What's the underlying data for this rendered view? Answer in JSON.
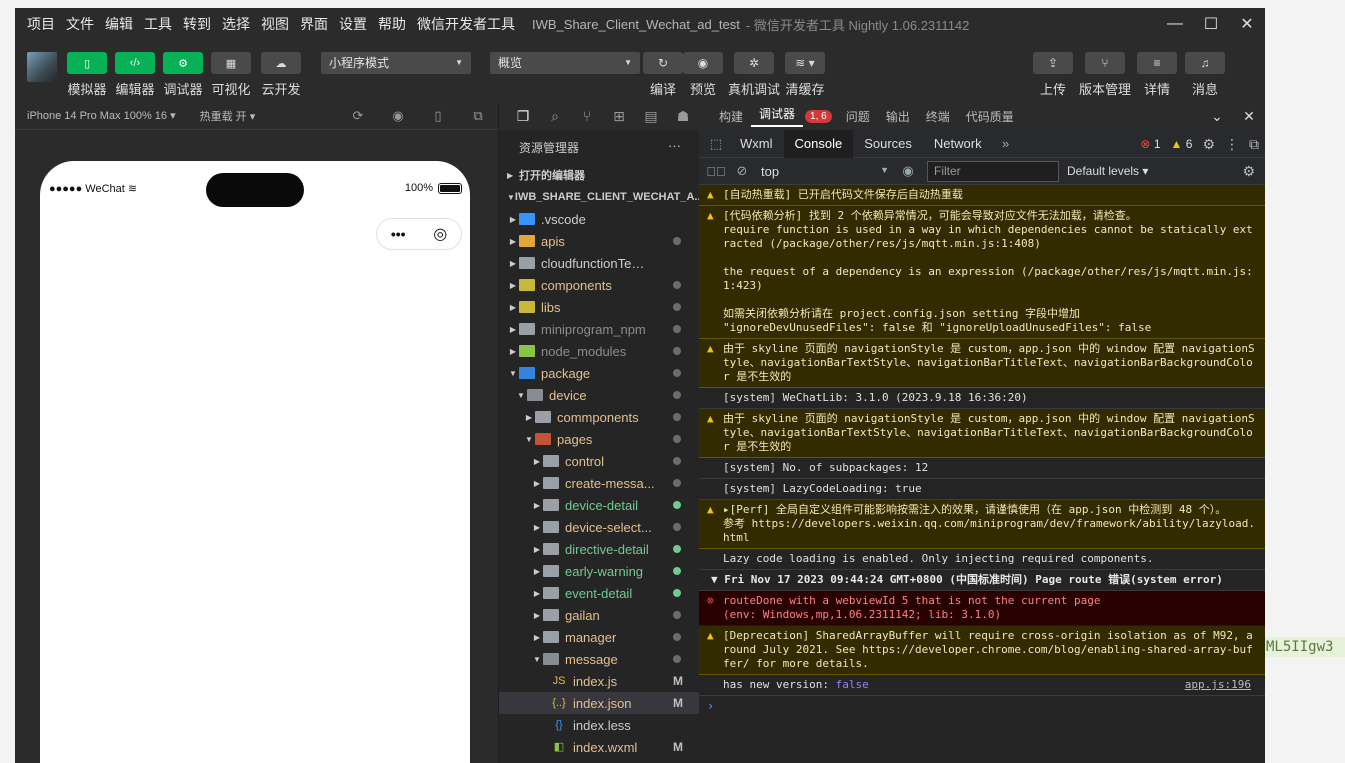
{
  "background_text": "ML5IIgw3",
  "menubar": {
    "items": [
      "项目",
      "文件",
      "编辑",
      "工具",
      "转到",
      "选择",
      "视图",
      "界面",
      "设置",
      "帮助",
      "微信开发者工具"
    ],
    "project_title": "IWB_Share_Client_Wechat_ad_test",
    "app_title": "- 微信开发者工具 Nightly 1.06.2311142"
  },
  "toolbar": {
    "left_buttons": [
      {
        "label": "模拟器",
        "icon": "phone-icon"
      },
      {
        "label": "编辑器",
        "icon": "code-icon"
      },
      {
        "label": "调试器",
        "icon": "debug-icon"
      },
      {
        "label": "可视化",
        "icon": "layout-icon"
      },
      {
        "label": "云开发",
        "icon": "cloud-icon"
      }
    ],
    "mode_select": "小程序模式",
    "compile_select": "概览",
    "center_buttons": [
      {
        "label": "编译",
        "icon": "refresh-icon"
      },
      {
        "label": "预览",
        "icon": "eye-icon"
      },
      {
        "label": "真机调试",
        "icon": "bug-icon"
      },
      {
        "label": "清缓存",
        "icon": "layers-icon"
      }
    ],
    "right_buttons": [
      {
        "label": "上传",
        "icon": "upload-icon"
      },
      {
        "label": "版本管理",
        "icon": "branch-icon"
      },
      {
        "label": "详情",
        "icon": "menu-icon"
      },
      {
        "label": "消息",
        "icon": "bell-icon"
      }
    ]
  },
  "simulator": {
    "device": "iPhone 14 Pro Max 100% 16 ▾",
    "hot_reload": "热重载 开 ▾",
    "status_left": "●●●●● WeChat",
    "battery": "100%",
    "capsule_more": "•••"
  },
  "explorer": {
    "header": "资源管理器",
    "open_editors": "打开的编辑器",
    "project": "IWB_SHARE_CLIENT_WECHAT_A...",
    "tree": [
      {
        "name": ".vscode",
        "depth": 1,
        "kind": "folder",
        "color": "#3794ff",
        "text_color": "#cccccc",
        "expanded": false,
        "dot": false
      },
      {
        "name": "apis",
        "depth": 1,
        "kind": "folder",
        "color": "#e0a73a",
        "text_color": "#e2c08d",
        "expanded": false,
        "dot": true
      },
      {
        "name": "cloudfunctionTemplate",
        "depth": 1,
        "kind": "folder",
        "color": "#9aa0a6",
        "text_color": "#cccccc",
        "expanded": false,
        "dot": false
      },
      {
        "name": "components",
        "depth": 1,
        "kind": "folder",
        "color": "#c5b83a",
        "text_color": "#e2c08d",
        "expanded": false,
        "dot": true
      },
      {
        "name": "libs",
        "depth": 1,
        "kind": "folder",
        "color": "#c5b83a",
        "text_color": "#e2c08d",
        "expanded": false,
        "dot": true
      },
      {
        "name": "miniprogram_npm",
        "depth": 1,
        "kind": "folder",
        "color": "#9aa0a6",
        "text_color": "#8c8c8c",
        "expanded": false,
        "dot": true
      },
      {
        "name": "node_modules",
        "depth": 1,
        "kind": "folder",
        "color": "#8bc34a",
        "text_color": "#8c8c8c",
        "expanded": false,
        "dot": true
      },
      {
        "name": "package",
        "depth": 1,
        "kind": "folder-open",
        "color": "#3794ff",
        "text_color": "#e2c08d",
        "expanded": true,
        "dot": true
      },
      {
        "name": "device",
        "depth": 2,
        "kind": "folder-open",
        "color": "#9aa0a6",
        "text_color": "#e2c08d",
        "expanded": true,
        "dot": true
      },
      {
        "name": "commponents",
        "depth": 3,
        "kind": "folder",
        "color": "#9aa0a6",
        "text_color": "#e2c08d",
        "expanded": false,
        "dot": true
      },
      {
        "name": "pages",
        "depth": 3,
        "kind": "folder-open",
        "color": "#e05a3a",
        "text_color": "#e2c08d",
        "expanded": true,
        "dot": true
      },
      {
        "name": "control",
        "depth": 4,
        "kind": "folder",
        "color": "#9aa0a6",
        "text_color": "#e2c08d",
        "expanded": false,
        "dot": true
      },
      {
        "name": "create-messa...",
        "depth": 4,
        "kind": "folder",
        "color": "#9aa0a6",
        "text_color": "#e2c08d",
        "expanded": false,
        "dot": true
      },
      {
        "name": "device-detail",
        "depth": 4,
        "kind": "folder",
        "color": "#9aa0a6",
        "text_color": "#73c991",
        "expanded": false,
        "dot": true,
        "dot_color": "#73c991"
      },
      {
        "name": "device-select...",
        "depth": 4,
        "kind": "folder",
        "color": "#9aa0a6",
        "text_color": "#e2c08d",
        "expanded": false,
        "dot": true
      },
      {
        "name": "directive-detail",
        "depth": 4,
        "kind": "folder",
        "color": "#9aa0a6",
        "text_color": "#73c991",
        "expanded": false,
        "dot": true,
        "dot_color": "#73c991"
      },
      {
        "name": "early-warning",
        "depth": 4,
        "kind": "folder",
        "color": "#9aa0a6",
        "text_color": "#73c991",
        "expanded": false,
        "dot": true,
        "dot_color": "#73c991"
      },
      {
        "name": "event-detail",
        "depth": 4,
        "kind": "folder",
        "color": "#9aa0a6",
        "text_color": "#73c991",
        "expanded": false,
        "dot": true,
        "dot_color": "#73c991"
      },
      {
        "name": "gailan",
        "depth": 4,
        "kind": "folder",
        "color": "#9aa0a6",
        "text_color": "#e2c08d",
        "expanded": false,
        "dot": true
      },
      {
        "name": "manager",
        "depth": 4,
        "kind": "folder",
        "color": "#9aa0a6",
        "text_color": "#e2c08d",
        "expanded": false,
        "dot": true
      },
      {
        "name": "message",
        "depth": 4,
        "kind": "folder-open",
        "color": "#9aa0a6",
        "text_color": "#e2c08d",
        "expanded": true,
        "dot": true
      },
      {
        "name": "index.js",
        "depth": 5,
        "kind": "file-js",
        "color": "#e0c13a",
        "text_color": "#e2c08d",
        "badge": "M"
      },
      {
        "name": "index.json",
        "depth": 5,
        "kind": "file-json",
        "color": "#e0c13a",
        "text_color": "#e2c08d",
        "badge": "M",
        "selected": true
      },
      {
        "name": "index.less",
        "depth": 5,
        "kind": "file-less",
        "color": "#3794ff",
        "text_color": "#cccccc"
      },
      {
        "name": "index.wxml",
        "depth": 5,
        "kind": "file-wxml",
        "color": "#8bc34a",
        "text_color": "#e2c08d",
        "badge": "M"
      }
    ]
  },
  "devtools": {
    "top_tabs": [
      {
        "label": "构建",
        "active": false
      },
      {
        "label": "调试器",
        "active": true,
        "count": "1, 6"
      },
      {
        "label": "问题",
        "active": false
      },
      {
        "label": "输出",
        "active": false
      },
      {
        "label": "终端",
        "active": false
      },
      {
        "label": "代码质量",
        "active": false
      }
    ],
    "chrome_tabs": [
      {
        "label": "Wxml",
        "active": false
      },
      {
        "label": "Console",
        "active": true
      },
      {
        "label": "Sources",
        "active": false
      },
      {
        "label": "Network",
        "active": false
      }
    ],
    "error_count": "1",
    "warning_count": "6",
    "context": "top",
    "filter_placeholder": "Filter",
    "levels": "Default levels ▾",
    "messages": [
      {
        "type": "warn",
        "text": "[自动热重载] 已开启代码文件保存后自动热重载"
      },
      {
        "type": "warn",
        "text": "[代码依赖分析] 找到 2 个依赖异常情况，可能会导致对应文件无法加载，请检查。\nrequire function is used in a way in which dependencies cannot be statically extracted (/package/other/res/js/mqtt.min.js:1:408)\n\nthe request of a dependency is an expression (/package/other/res/js/mqtt.min.js:1:423)\n\n如需关闭依赖分析请在 project.config.json setting 字段中增加\n\"ignoreDevUnusedFiles\": false 和 \"ignoreUploadUnusedFiles\": false"
      },
      {
        "type": "warn",
        "text": "由于 skyline 页面的 navigationStyle 是 custom，app.json 中的 window 配置 navigationStyle、navigationBarTextStyle、navigationBarTitleText、navigationBarBackgroundColor 是不生效的"
      },
      {
        "type": "log",
        "text": "[system] WeChatLib: 3.1.0 (2023.9.18 16:36:20)"
      },
      {
        "type": "warn",
        "text": "由于 skyline 页面的 navigationStyle 是 custom，app.json 中的 window 配置 navigationStyle、navigationBarTextStyle、navigationBarTitleText、navigationBarBackgroundColor 是不生效的"
      },
      {
        "type": "log",
        "text": "[system] No. of subpackages: 12"
      },
      {
        "type": "log",
        "text": "[system] LazyCodeLoading: true"
      },
      {
        "type": "warn",
        "text": "▸[Perf] 全局自定义组件可能影响按需注入的效果，请谨慎使用（在 app.json 中检测到 48 个）。\n参考 https://developers.weixin.qq.com/miniprogram/dev/framework/ability/lazyload.html"
      },
      {
        "type": "log",
        "text": "Lazy code loading is enabled. Only injecting required components."
      },
      {
        "type": "group",
        "text": "▼ Fri Nov 17 2023 09:44:24 GMT+0800 (中国标准时间) Page route 错误(system error)"
      },
      {
        "type": "err",
        "text": "routeDone with a webviewId 5 that is not the current page\n(env: Windows,mp,1.06.2311142; lib: 3.1.0)"
      },
      {
        "type": "warn",
        "text": "[Deprecation] SharedArrayBuffer will require cross-origin isolation as of M92, around July 2021. See https://developer.chrome.com/blog/enabling-shared-array-buffer/ for more details."
      },
      {
        "type": "log",
        "text": "has new version: ",
        "value": "false",
        "source": "app.js:196"
      }
    ],
    "prompt": "›"
  }
}
